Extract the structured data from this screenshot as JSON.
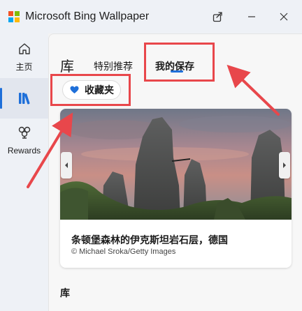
{
  "window": {
    "title": "Microsoft Bing Wallpaper",
    "logo_colors": [
      "#f35325",
      "#81bc06",
      "#05a6f0",
      "#ffba08"
    ]
  },
  "nav": {
    "items": [
      {
        "label": "主页",
        "icon": "home-icon"
      },
      {
        "label": "",
        "icon": "library-icon",
        "selected": true
      },
      {
        "label": "Rewards",
        "icon": "rewards-trophy-icon"
      }
    ]
  },
  "main": {
    "heading": "库",
    "tabs": [
      {
        "label": "特别推荐"
      },
      {
        "label": "我的保存",
        "active": true
      }
    ],
    "favorites_button": {
      "label": "收藏夹",
      "icon": "heart-icon"
    },
    "card": {
      "title": "条顿堡森林的伊克斯坦岩石层，德国",
      "credit": "© Michael Sroka/Getty Images"
    },
    "section_heading": "库"
  },
  "colors": {
    "accent": "#1e6fd9",
    "annotation": "#e8474b"
  }
}
